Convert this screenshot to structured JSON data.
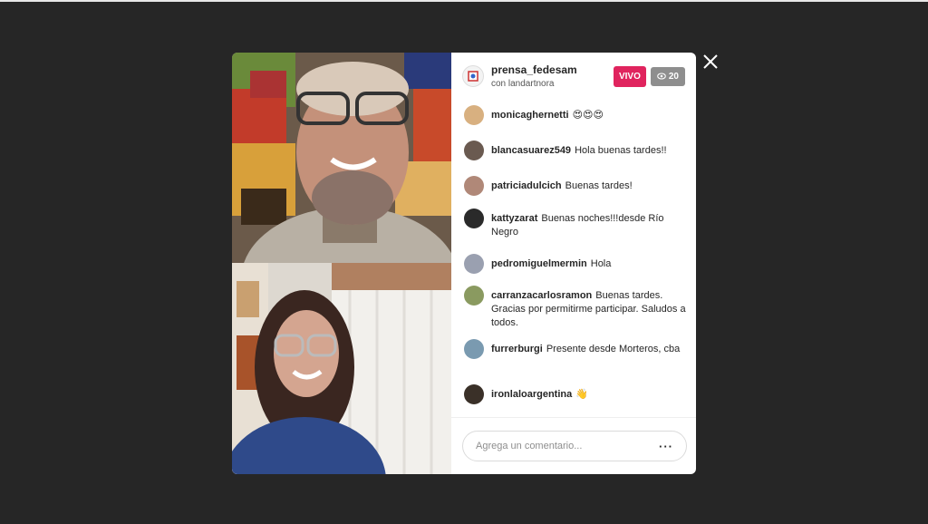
{
  "stream": {
    "host_name": "prensa_fedesam",
    "host_subtitle": "con landartnora",
    "live_label": "VIVO",
    "viewer_count": "20"
  },
  "comments": [
    {
      "user": "monicaghernetti",
      "text": "😍😍😍"
    },
    {
      "user": "blancasuarez549",
      "text": "Hola buenas tardes!!"
    },
    {
      "user": "patriciadulcich",
      "text": "Buenas tardes!"
    },
    {
      "user": "kattyzarat",
      "text": "Buenas noches!!!desde Río Negro"
    },
    {
      "user": "pedromiguelmermin",
      "text": "Hola"
    },
    {
      "user": "carranzacarlosramon",
      "text": "Buenas tardes. Gracias por permitirme participar. Saludos a todos."
    },
    {
      "user": "furrerburgi",
      "text": "Presente desde Morteros, cba"
    },
    {
      "user": "ironlaloargentina",
      "text": "👋"
    }
  ],
  "comment_box": {
    "placeholder": "Agrega un comentario...",
    "more_label": "···"
  },
  "colors": {
    "live": "#e0245e",
    "views": "#8e8e8e",
    "backdrop": "#262626"
  },
  "icons": [
    "close-icon",
    "eye-icon",
    "more-icon"
  ]
}
